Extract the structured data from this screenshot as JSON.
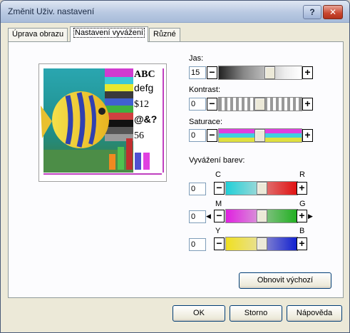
{
  "window": {
    "title": "Změnit Uživ. nastavení"
  },
  "titlebar": {
    "help_label": "?",
    "close_label": "✕"
  },
  "tabs": [
    {
      "label": "Úprava obrazu"
    },
    {
      "label": "Nastavení vyvážení"
    },
    {
      "label": "Různé"
    }
  ],
  "preview": {
    "texts": [
      "ABC",
      "defg",
      "$12",
      "@&?",
      "56"
    ]
  },
  "sliders": {
    "jas": {
      "label": "Jas:",
      "value": "15"
    },
    "kontrast": {
      "label": "Kontrast:",
      "value": "0"
    },
    "saturace": {
      "label": "Saturace:",
      "value": "0"
    }
  },
  "color_balance": {
    "label": "Vyvážení barev:",
    "rows": [
      {
        "left": "C",
        "right": "R",
        "value": "0"
      },
      {
        "left": "M",
        "right": "G",
        "value": "0"
      },
      {
        "left": "Y",
        "right": "B",
        "value": "0"
      }
    ]
  },
  "controls": {
    "minus": "−",
    "plus": "+"
  },
  "buttons": {
    "reset": "Obnovit výchozí",
    "ok": "OK",
    "cancel": "Storno",
    "help": "Nápověda"
  }
}
